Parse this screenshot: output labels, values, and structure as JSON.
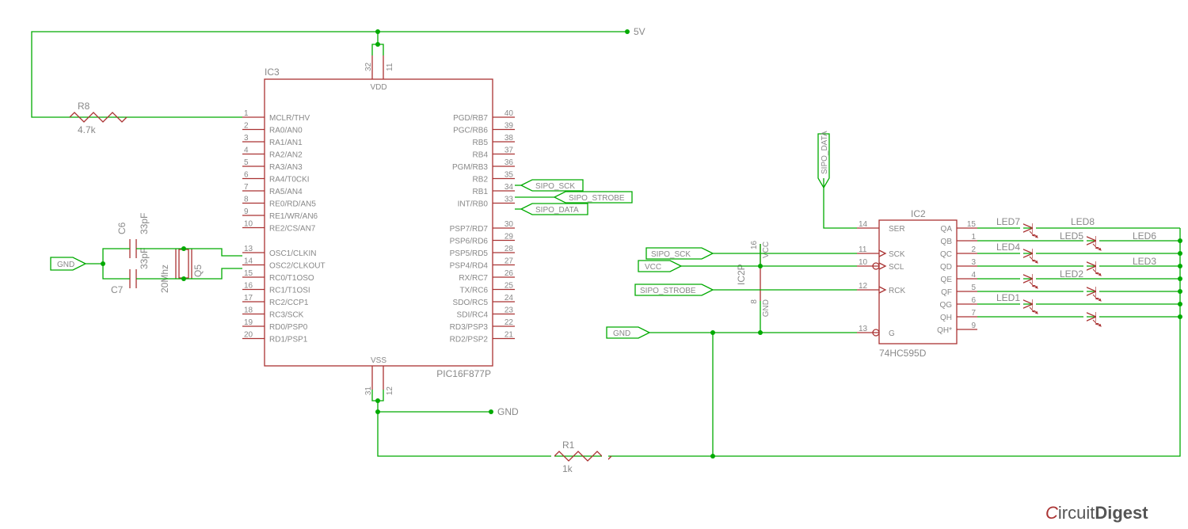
{
  "power": {
    "v5": "5V",
    "gnd": "GND",
    "vcc": "VCC"
  },
  "nets": {
    "sck": "SIPO_SCK",
    "strobe": "SIPO_STROBE",
    "data": "SIPO_DATA"
  },
  "ic3": {
    "ref": "IC3",
    "part": "PIC16F877P",
    "vdd": "VDD",
    "vss": "VSS",
    "pins_left": [
      {
        "n": "1",
        "name": "MCLR/THV"
      },
      {
        "n": "2",
        "name": "RA0/AN0"
      },
      {
        "n": "3",
        "name": "RA1/AN1"
      },
      {
        "n": "4",
        "name": "RA2/AN2"
      },
      {
        "n": "5",
        "name": "RA3/AN3"
      },
      {
        "n": "6",
        "name": "RA4/T0CKI"
      },
      {
        "n": "7",
        "name": "RA5/AN4"
      },
      {
        "n": "8",
        "name": "RE0/RD/AN5"
      },
      {
        "n": "9",
        "name": "RE1/WR/AN6"
      },
      {
        "n": "10",
        "name": "RE2/CS/AN7"
      },
      {
        "n": "13",
        "name": "OSC1/CLKIN"
      },
      {
        "n": "14",
        "name": "OSC2/CLKOUT"
      },
      {
        "n": "15",
        "name": "RC0/T1OSO"
      },
      {
        "n": "16",
        "name": "RC1/T1OSI"
      },
      {
        "n": "17",
        "name": "RC2/CCP1"
      },
      {
        "n": "18",
        "name": "RC3/SCK"
      },
      {
        "n": "19",
        "name": "RD0/PSP0"
      },
      {
        "n": "20",
        "name": "RD1/PSP1"
      }
    ],
    "pins_right": [
      {
        "n": "40",
        "name": "PGD/RB7"
      },
      {
        "n": "39",
        "name": "PGC/RB6"
      },
      {
        "n": "38",
        "name": "RB5"
      },
      {
        "n": "37",
        "name": "RB4"
      },
      {
        "n": "36",
        "name": "PGM/RB3"
      },
      {
        "n": "35",
        "name": "RB2"
      },
      {
        "n": "34",
        "name": "RB1"
      },
      {
        "n": "33",
        "name": "INT/RB0"
      },
      {
        "n": "30",
        "name": "PSP7/RD7"
      },
      {
        "n": "29",
        "name": "PSP6/RD6"
      },
      {
        "n": "28",
        "name": "PSP5/RD5"
      },
      {
        "n": "27",
        "name": "PSP4/RD4"
      },
      {
        "n": "26",
        "name": "RX/RC7"
      },
      {
        "n": "25",
        "name": "TX/RC6"
      },
      {
        "n": "24",
        "name": "SDO/RC5"
      },
      {
        "n": "23",
        "name": "SDI/RC4"
      },
      {
        "n": "22",
        "name": "RD3/PSP3"
      },
      {
        "n": "21",
        "name": "RD2/PSP2"
      }
    ],
    "vdd_pins": [
      "32",
      "11"
    ],
    "vss_pins": [
      "31",
      "12"
    ]
  },
  "ic2": {
    "ref": "IC2",
    "part": "74HC595D",
    "power_ref": "IC2P",
    "vcc_pin": "16",
    "gnd_pin": "8",
    "pins_left": [
      {
        "n": "14",
        "name": "SER"
      },
      {
        "n": "11",
        "name": "SCK"
      },
      {
        "n": "10",
        "name": "SCL"
      },
      {
        "n": "12",
        "name": "RCK"
      },
      {
        "n": "13",
        "name": "G"
      }
    ],
    "pins_right": [
      {
        "n": "15",
        "name": "QA"
      },
      {
        "n": "1",
        "name": "QB"
      },
      {
        "n": "2",
        "name": "QC"
      },
      {
        "n": "3",
        "name": "QD"
      },
      {
        "n": "4",
        "name": "QE"
      },
      {
        "n": "5",
        "name": "QF"
      },
      {
        "n": "6",
        "name": "QG"
      },
      {
        "n": "7",
        "name": "QH"
      },
      {
        "n": "9",
        "name": "QH*"
      }
    ]
  },
  "r8": {
    "ref": "R8",
    "val": "4.7k"
  },
  "r1": {
    "ref": "R1",
    "val": "1k"
  },
  "c6": {
    "ref": "C6",
    "val": "33pF"
  },
  "c7": {
    "ref": "C7",
    "val": "33pF"
  },
  "q5": {
    "ref": "Q5",
    "val": "20Mhz"
  },
  "leds": [
    "LED1",
    "LED2",
    "LED3",
    "LED4",
    "LED5",
    "LED6",
    "LED7",
    "LED8"
  ],
  "logo": {
    "a": "C",
    "b": "ircuit",
    "c": "Digest"
  }
}
